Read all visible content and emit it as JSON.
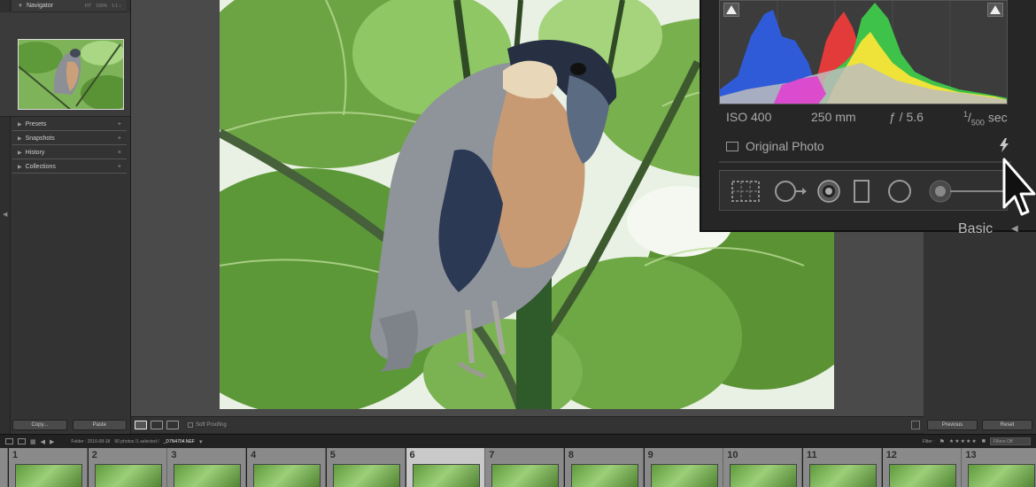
{
  "navigator": {
    "title": "Navigator",
    "zoom_fit": "FIT",
    "zoom_1": "100%",
    "zoom_2": "1:1 ↕"
  },
  "left_sections": [
    "Presets",
    "Snapshots",
    "History",
    "Collections"
  ],
  "left_buttons": {
    "copy": "Copy...",
    "paste": "Paste"
  },
  "toolbar": {
    "soft_proofing": "Soft Proofing"
  },
  "right_buttons": {
    "previous": "Previous",
    "reset": "Reset"
  },
  "histogram": {
    "iso": "ISO 400",
    "focal": "250 mm",
    "aperture": "ƒ / 5.6",
    "shutter_num": "1",
    "shutter_den": "500",
    "shutter_unit": "sec",
    "original_photo": "Original Photo",
    "panel_label": "Basic"
  },
  "filmstrip_bar": {
    "folder": "Folder : 2016-08-18",
    "count": "90 photos /1 selected /",
    "file": "_D7N4704.NEF",
    "filter": "Filter :",
    "filter_off": "Filters Off"
  },
  "filmstrip": {
    "numbers": [
      "1",
      "2",
      "3",
      "4",
      "5",
      "6",
      "7",
      "8",
      "9",
      "10",
      "11",
      "12",
      "13"
    ],
    "selected_index": 5
  },
  "colors": {
    "accent": "#cfcfcf",
    "panel": "#333333"
  }
}
